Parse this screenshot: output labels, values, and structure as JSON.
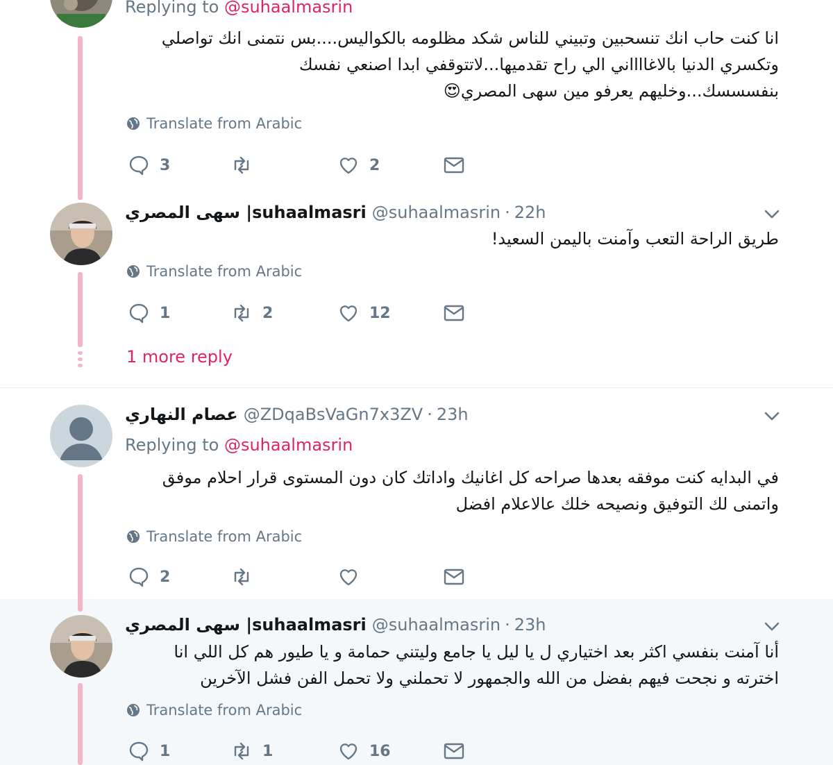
{
  "tweets": [
    {
      "replying_prefix": "Replying to",
      "replying_to": "@suhaalmasrin",
      "text": "انا كنت حاب انك تنسحبين وتبيني للناس شكد مظلومه بالكواليس....بس نتمنى انك تواصلي وتكسري الدنيا بالاغااااني الي راح تقدميها...لاتتوقفي ابدا اصنعي نفسك بنفسسسك...وخليهم يعرفو مين سهى المصري😍",
      "translate": "Translate from Arabic",
      "stats": {
        "replies": "3",
        "retweets": "",
        "likes": "2"
      }
    },
    {
      "name": "سهى المصري |suhaalmasri",
      "handle": "@suhaalmasrin",
      "separator": "·",
      "time": "22h",
      "text": "طريق الراحة التعب وآمنت باليمن السعيد!",
      "translate": "Translate from Arabic",
      "stats": {
        "replies": "1",
        "retweets": "2",
        "likes": "12"
      }
    },
    {
      "name": "عصام النهاري",
      "handle": "@ZDqaBsVaGn7x3ZV",
      "separator": "·",
      "time": "23h",
      "replying_prefix": "Replying to",
      "replying_to": "@suhaalmasrin",
      "text": "في البدايه كنت موفقه بعدها صراحه كل اغانيك واداتك كان دون المستوى قرار احلام موفق واتمنى لك التوفيق ونصيحه خلك عالاعلام افضل",
      "translate": "Translate from Arabic",
      "stats": {
        "replies": "2",
        "retweets": "",
        "likes": ""
      }
    },
    {
      "name": "سهى المصري |suhaalmasri",
      "handle": "@suhaalmasrin",
      "separator": "·",
      "time": "23h",
      "text": "أنا آمنت بنفسي اكثر بعد اختياري ل يا ليل يا جامع وليتني حمامة و يا طيور هم كل اللي انا اخترته و نجحت فيهم بفضل من الله والجمهور لا تحملني ولا تحمل الفن فشل الآخرين",
      "translate": "Translate from Arabic",
      "stats": {
        "replies": "1",
        "retweets": "1",
        "likes": "16"
      }
    }
  ],
  "more_replies": "1 more reply",
  "icons": {
    "reply": "reply-icon",
    "retweet": "retweet-icon",
    "like": "heart-icon",
    "dm": "envelope-icon",
    "globe": "globe-icon",
    "caret": "chevron-down-icon"
  },
  "colors": {
    "accent": "#e0245e",
    "thread_line": "#f3b6c6",
    "secondary_text": "#657786",
    "highlight_bg": "#f5f8fa"
  }
}
